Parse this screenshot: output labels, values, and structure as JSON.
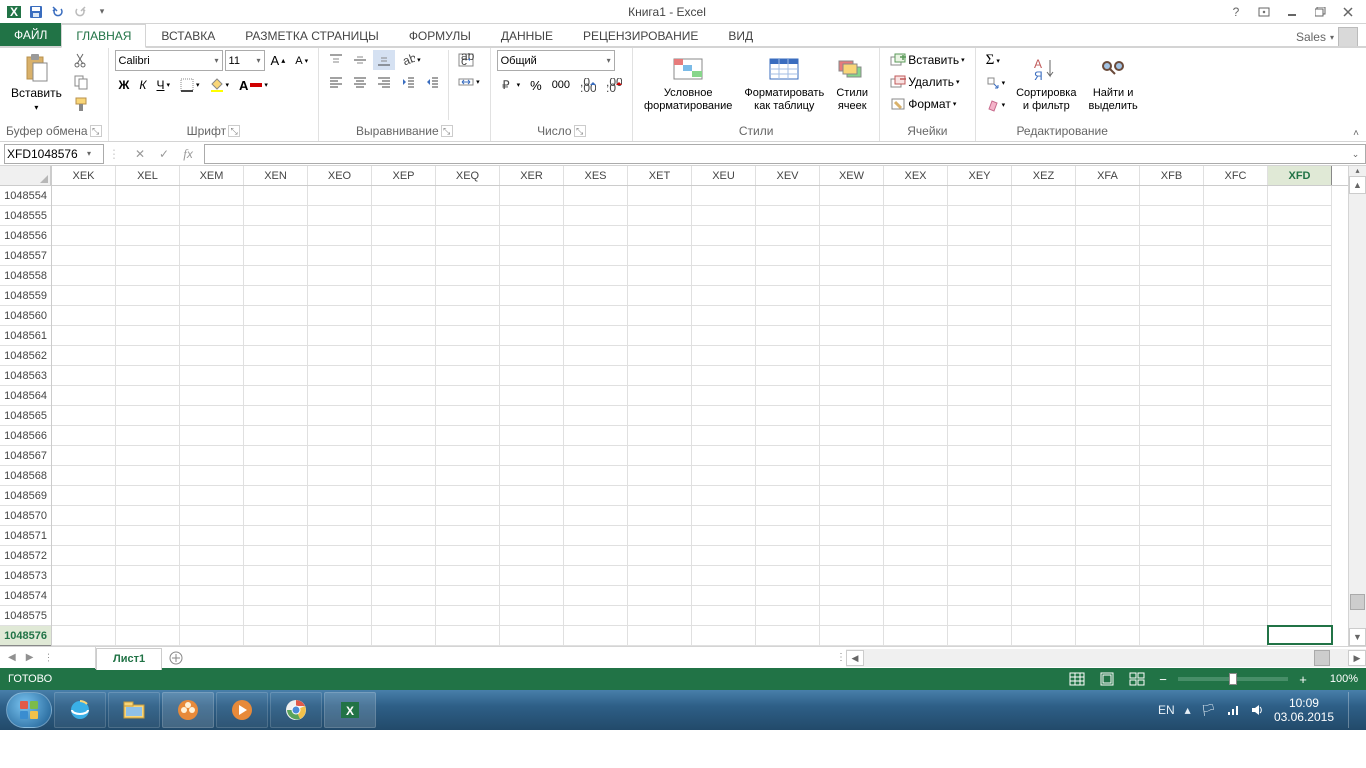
{
  "title": "Книга1 - Excel",
  "account": "Sales",
  "tabs": {
    "file": "ФАЙЛ",
    "items": [
      "ГЛАВНАЯ",
      "ВСТАВКА",
      "РАЗМЕТКА СТРАНИЦЫ",
      "ФОРМУЛЫ",
      "ДАННЫЕ",
      "РЕЦЕНЗИРОВАНИЕ",
      "ВИД"
    ],
    "active": 0
  },
  "ribbon": {
    "clipboard": {
      "paste": "Вставить",
      "label": "Буфер обмена"
    },
    "font": {
      "name": "Calibri",
      "size": "11",
      "bold": "Ж",
      "italic": "К",
      "underline": "Ч",
      "label": "Шрифт"
    },
    "align": {
      "label": "Выравнивание"
    },
    "number": {
      "format": "Общий",
      "label": "Число"
    },
    "styles": {
      "cond": "Условное\nформатирование",
      "table": "Форматировать\nкак таблицу",
      "cell": "Стили\nячеек",
      "label": "Стили"
    },
    "cells": {
      "insert": "Вставить",
      "delete": "Удалить",
      "format": "Формат",
      "label": "Ячейки"
    },
    "editing": {
      "sort": "Сортировка\nи фильтр",
      "find": "Найти и\nвыделить",
      "label": "Редактирование"
    }
  },
  "namebox": "XFD1048576",
  "columns": [
    "XEK",
    "XEL",
    "XEM",
    "XEN",
    "XEO",
    "XEP",
    "XEQ",
    "XER",
    "XES",
    "XET",
    "XEU",
    "XEV",
    "XEW",
    "XEX",
    "XEY",
    "XEZ",
    "XFA",
    "XFB",
    "XFC",
    "XFD"
  ],
  "rows": [
    "1048554",
    "1048555",
    "1048556",
    "1048557",
    "1048558",
    "1048559",
    "1048560",
    "1048561",
    "1048562",
    "1048563",
    "1048564",
    "1048565",
    "1048566",
    "1048567",
    "1048568",
    "1048569",
    "1048570",
    "1048571",
    "1048572",
    "1048573",
    "1048574",
    "1048575",
    "1048576"
  ],
  "selected_col": "XFD",
  "selected_row": "1048576",
  "sheet": {
    "name": "Лист1"
  },
  "status": {
    "ready": "ГОТОВО",
    "zoom": "100%"
  },
  "taskbar": {
    "lang": "EN",
    "time": "10:09",
    "date": "03.06.2015"
  }
}
